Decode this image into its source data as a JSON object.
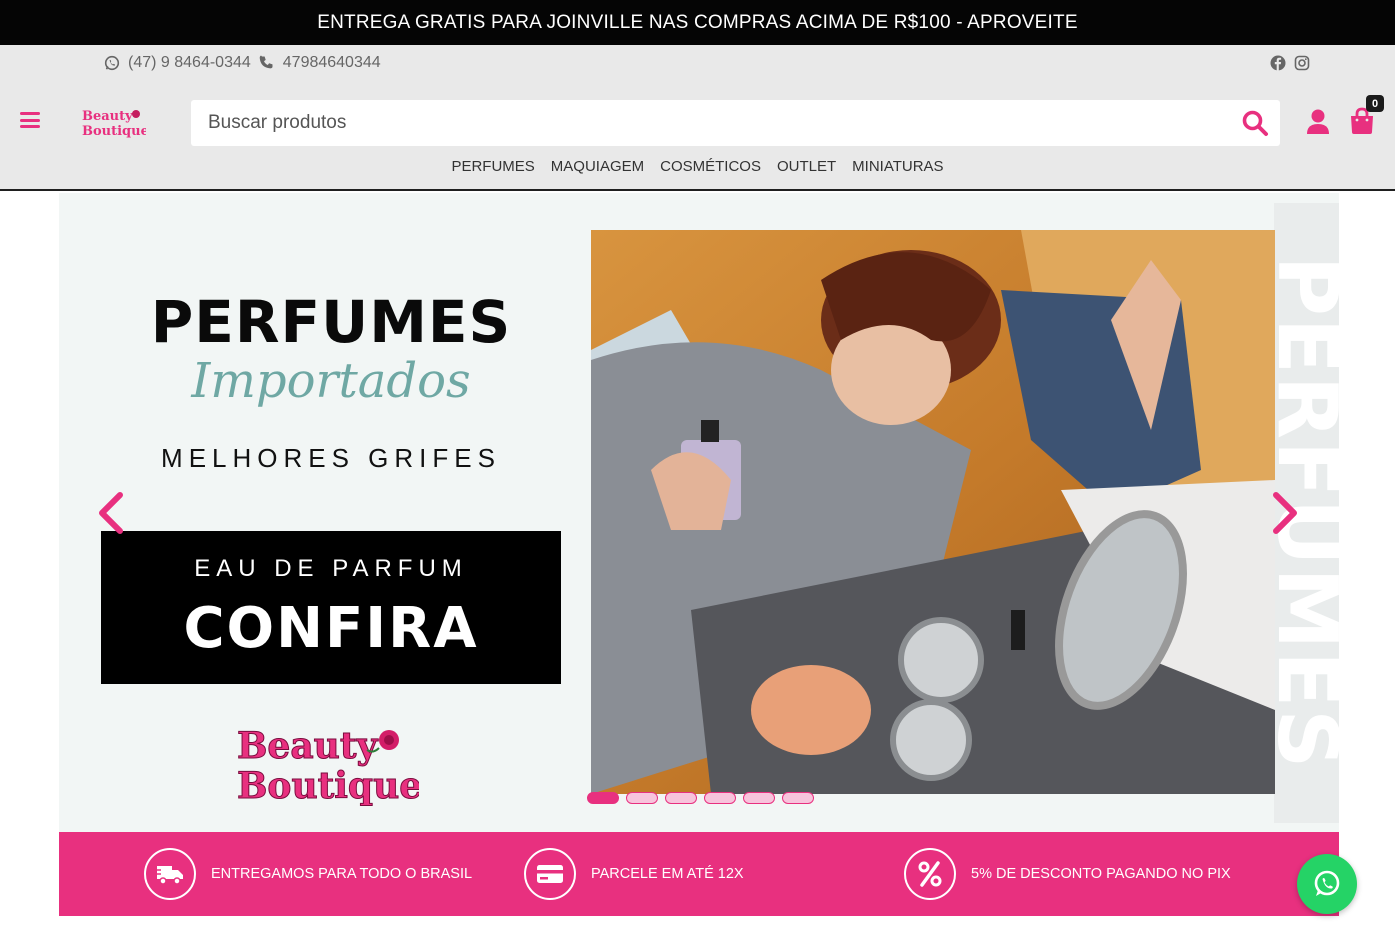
{
  "topbar": {
    "announcement": "ENTREGA GRATIS PARA JOINVILLE NAS COMPRAS ACIMA DE R$100 - APROVEITE"
  },
  "header": {
    "whatsapp_number": "(47) 9 8464-0344",
    "phone_number": "47984640344",
    "logo_text_line1": "Beauty",
    "logo_text_line2": "Boutique",
    "search_placeholder": "Buscar produtos",
    "cart_count": "0",
    "social_icons": [
      "facebook-icon",
      "instagram-icon"
    ]
  },
  "nav": {
    "items": [
      {
        "label": "PERFUMES"
      },
      {
        "label": "MAQUIAGEM"
      },
      {
        "label": "COSMÉTICOS"
      },
      {
        "label": "OUTLET"
      },
      {
        "label": "MINIATURAS"
      }
    ]
  },
  "slider": {
    "title": "PERFUMES",
    "script_text": "Importados",
    "subtitle": "MELHORES GRIFES",
    "cta_small": "EAU DE PARFUM",
    "cta_big": "CONFIRA",
    "vertical_text": "PERFUMES",
    "logo_line1": "Beauty",
    "logo_line2": "Boutique",
    "dots_count": 6,
    "active_dot": 0
  },
  "features": [
    {
      "icon": "truck-icon",
      "label": "ENTREGAMOS PARA TODO O BRASIL"
    },
    {
      "icon": "credit-card-icon",
      "label": "PARCELE EM ATÉ 12X"
    },
    {
      "icon": "percent-icon",
      "label": "5% DE DESCONTO PAGANDO NO PIX"
    }
  ],
  "colors": {
    "brand_pink": "#e8307f",
    "topbar_bg": "#050505",
    "header_bg": "#e9e9e9",
    "whatsapp_green": "#25d366"
  }
}
